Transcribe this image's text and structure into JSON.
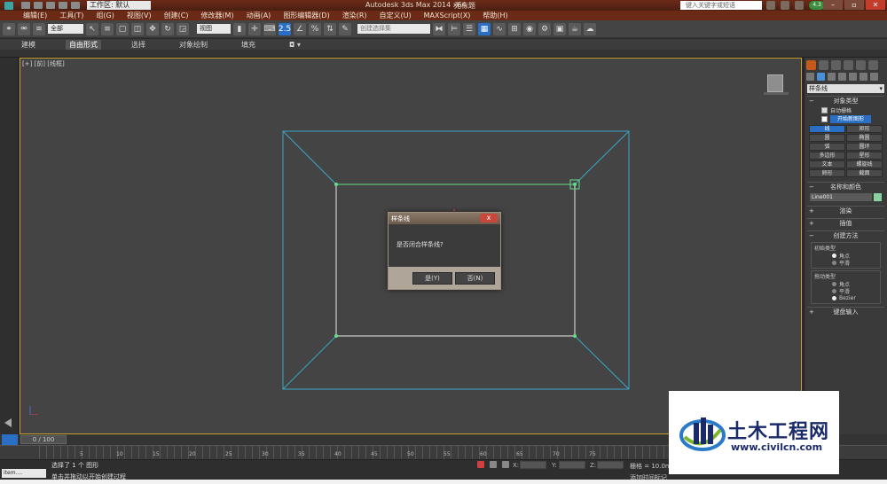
{
  "titlebar": {
    "workspace": "工作区: 默认",
    "app_title": "Autodesk 3ds Max 2014 x64",
    "file_title": "无标题",
    "search_placeholder": "键入关键字或短语",
    "login_badge": "4.3"
  },
  "menu": [
    "编辑(E)",
    "工具(T)",
    "组(G)",
    "视图(V)",
    "创建(C)",
    "修改器(M)",
    "动画(A)",
    "图形编辑器(D)",
    "渲染(R)",
    "自定义(U)",
    "MAXScript(X)",
    "帮助(H)"
  ],
  "toolbar": {
    "selection_filter": "全部",
    "ref_coord": "视图",
    "selection_set_placeholder": "创建选择集"
  },
  "ribbon": {
    "tabs": [
      "建模",
      "自由形式",
      "选择",
      "对象绘制",
      "填充"
    ]
  },
  "viewport": {
    "label": "[+] [前] [线框]"
  },
  "dialog": {
    "title": "样条线",
    "message": "是否闭合样条线?",
    "yes_label": "是(Y)",
    "no_label": "否(N)",
    "close_label": "x"
  },
  "command_panel": {
    "category": "样条线",
    "object_type_title": "对象类型",
    "auto_grid_label": "自动栅格",
    "start_new_shape_label": "开始新图形",
    "objects": [
      "线",
      "矩形",
      "圆",
      "椭圆",
      "弧",
      "圆环",
      "多边形",
      "星形",
      "文本",
      "螺旋线",
      "卵形",
      "截面"
    ],
    "name_color_title": "名称和颜色",
    "object_name": "Line001",
    "rendering_title": "渲染",
    "interpolation_title": "插值",
    "creation_method_title": "创建方法",
    "initial_type_title": "初始类型",
    "initial_options": [
      "角点",
      "平滑"
    ],
    "drag_type_title": "拖动类型",
    "drag_options": [
      "角点",
      "平滑",
      "Bezier"
    ],
    "keyboard_entry_title": "键盘输入"
  },
  "timeline": {
    "slider_label": "0 / 100",
    "ticks": [
      "5",
      "10",
      "15",
      "20",
      "25",
      "30",
      "35",
      "40",
      "45",
      "50",
      "55",
      "60",
      "65",
      "70",
      "75"
    ]
  },
  "status": {
    "selection_status": "选择了 1 个 图形",
    "prompt": "单击并拖动以开始创建过程",
    "maxscript": "item....",
    "x_label": "X:",
    "y_label": "Y:",
    "z_label": "Z:",
    "grid": "栅格 = 10.0mm",
    "add_time_tag": "添加时间标记"
  },
  "watermark": {
    "title": "土木工程网",
    "url": "www.civilcn.com"
  },
  "colors": {
    "accent": "#2a6fc4",
    "title_bar": "#6a2a15",
    "viewport_border": "#c9a130",
    "spline_green": "#66dd88",
    "spline_blue": "#3aa6c8"
  }
}
